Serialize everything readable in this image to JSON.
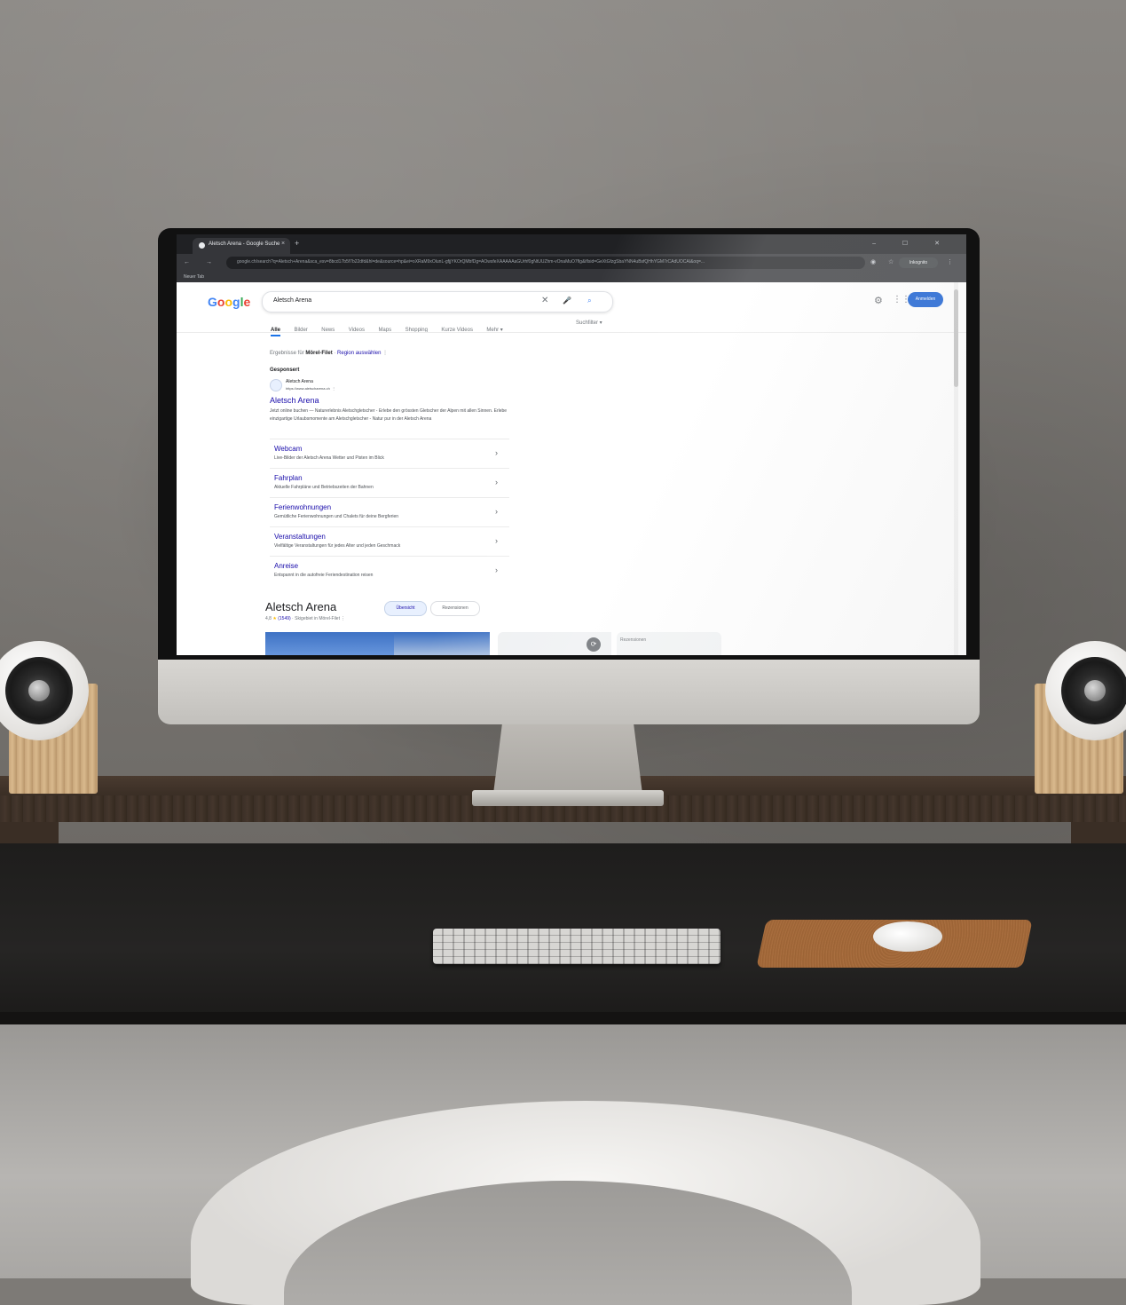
{
  "browser": {
    "tab_title": "Aletsch Arena - Google Suche",
    "tab_close": "×",
    "tab_add": "+",
    "window_controls": "– ☐ ✕",
    "nav_icons": "← → ⟳",
    "omnibox_url": "google.ch/search?q=Aletsch+Arena&sca_esv=8bcd17b5f7b22dfd&hl=de&source=hp&ei=oXRaM9xOlunL-gfjjYKOrQMbfDg=AOwsfeXAAAAAaGUrhf0gNtUUZhm-vOnaMuO7flg&iflsid=GeXtGfzgSbaYNN4uBsfQHhYGM7rCAdUOCAI&oq=...",
    "omnibox_icons": "◉ ☆",
    "profile_label": "Inkognito",
    "menu_dots": "⋮",
    "bookmark": "Neuer Tab"
  },
  "google": {
    "logo_letters": [
      "G",
      "o",
      "o",
      "g",
      "l",
      "e"
    ],
    "logo_colors": [
      "#4285f4",
      "#ea4335",
      "#fbbc05",
      "#4285f4",
      "#34a853",
      "#ea4335"
    ],
    "search_query": "Aletsch Arena",
    "search_clear": "✕",
    "search_icons": "🎤 ⌕",
    "settings_icon": "⚙",
    "apps_icon": "⋮⋮",
    "signin_label": "Anmelden",
    "tabs": [
      "Alle",
      "Bilder",
      "News",
      "Videos",
      "Maps",
      "Shopping",
      "Kurze Videos",
      "Mehr ▾"
    ],
    "tools_label": "Suchfilter ▾",
    "location_prefix": "Ergebnisse für ",
    "location_place": "Mörel-Filet",
    "location_sep": " · ",
    "location_link": "Region auswählen",
    "location_more": "⋮"
  },
  "ad": {
    "sponsored_label": "Gesponsert",
    "site_name": "Aletsch Arena",
    "site_url": "https://www.aletscharena.ch",
    "site_more": "⋮",
    "title": "Aletsch Arena",
    "description": "Jetzt online buchen — Naturerlebnis Aletschgletscher - Erlebe den grössten Gletscher der Alpen mit allen Sinnen. Erlebe einzigartige Urlaubsmomente am Aletschgletscher - Natur pur in der Aletsch Arena",
    "sitelinks": [
      {
        "title": "Webcam",
        "desc": "Live-Bilder der Aletsch Arena Wetter und Pisten im Blick"
      },
      {
        "title": "Fahrplan",
        "desc": "Aktuelle Fahrpläne und Betriebszeiten der Bahnen"
      },
      {
        "title": "Ferienwohnungen",
        "desc": "Gemütliche Ferienwohnungen und Chalets für deine Bergferien"
      },
      {
        "title": "Veranstaltungen",
        "desc": "Vielfältige Veranstaltungen für jedes Alter und jeden Geschmack"
      },
      {
        "title": "Anreise",
        "desc": "Entspannt in die autofreie Feriendestination reisen"
      }
    ],
    "chevron": "›"
  },
  "knowledge_panel": {
    "title": "Aletsch Arena",
    "rating_value": "4,8",
    "stars": "★",
    "review_count": "(1549)",
    "rating_suffix": " · Skigebiet in Mörel-Filet",
    "rating_more": "⋮",
    "chip_overview": "Übersicht",
    "chip_reviews": "Rezensionen",
    "map_button": "⟳",
    "reviews_label": "Rezensionen"
  },
  "desk": {
    "apple_logo": ""
  }
}
